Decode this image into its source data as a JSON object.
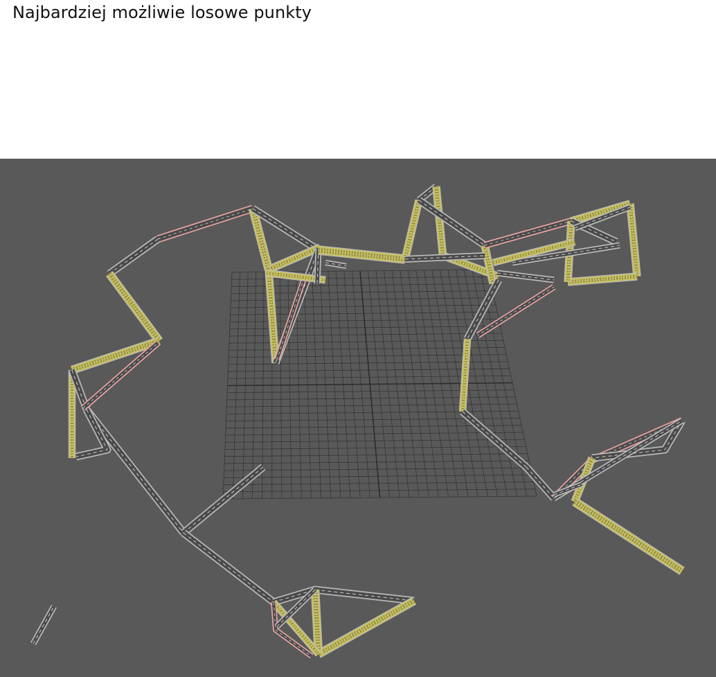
{
  "page": {
    "title": "Najbardziej możliwie losowe punkty"
  },
  "viewport": {
    "background": "#595959",
    "grid_color": "#2a2a2a",
    "road_asphalt": "#4a4a4a",
    "road_edge": "#b9b9b9",
    "road_pink": "#e7a3a0",
    "road_yellow": "#c8c15f",
    "road_center": "#e0d84a"
  }
}
